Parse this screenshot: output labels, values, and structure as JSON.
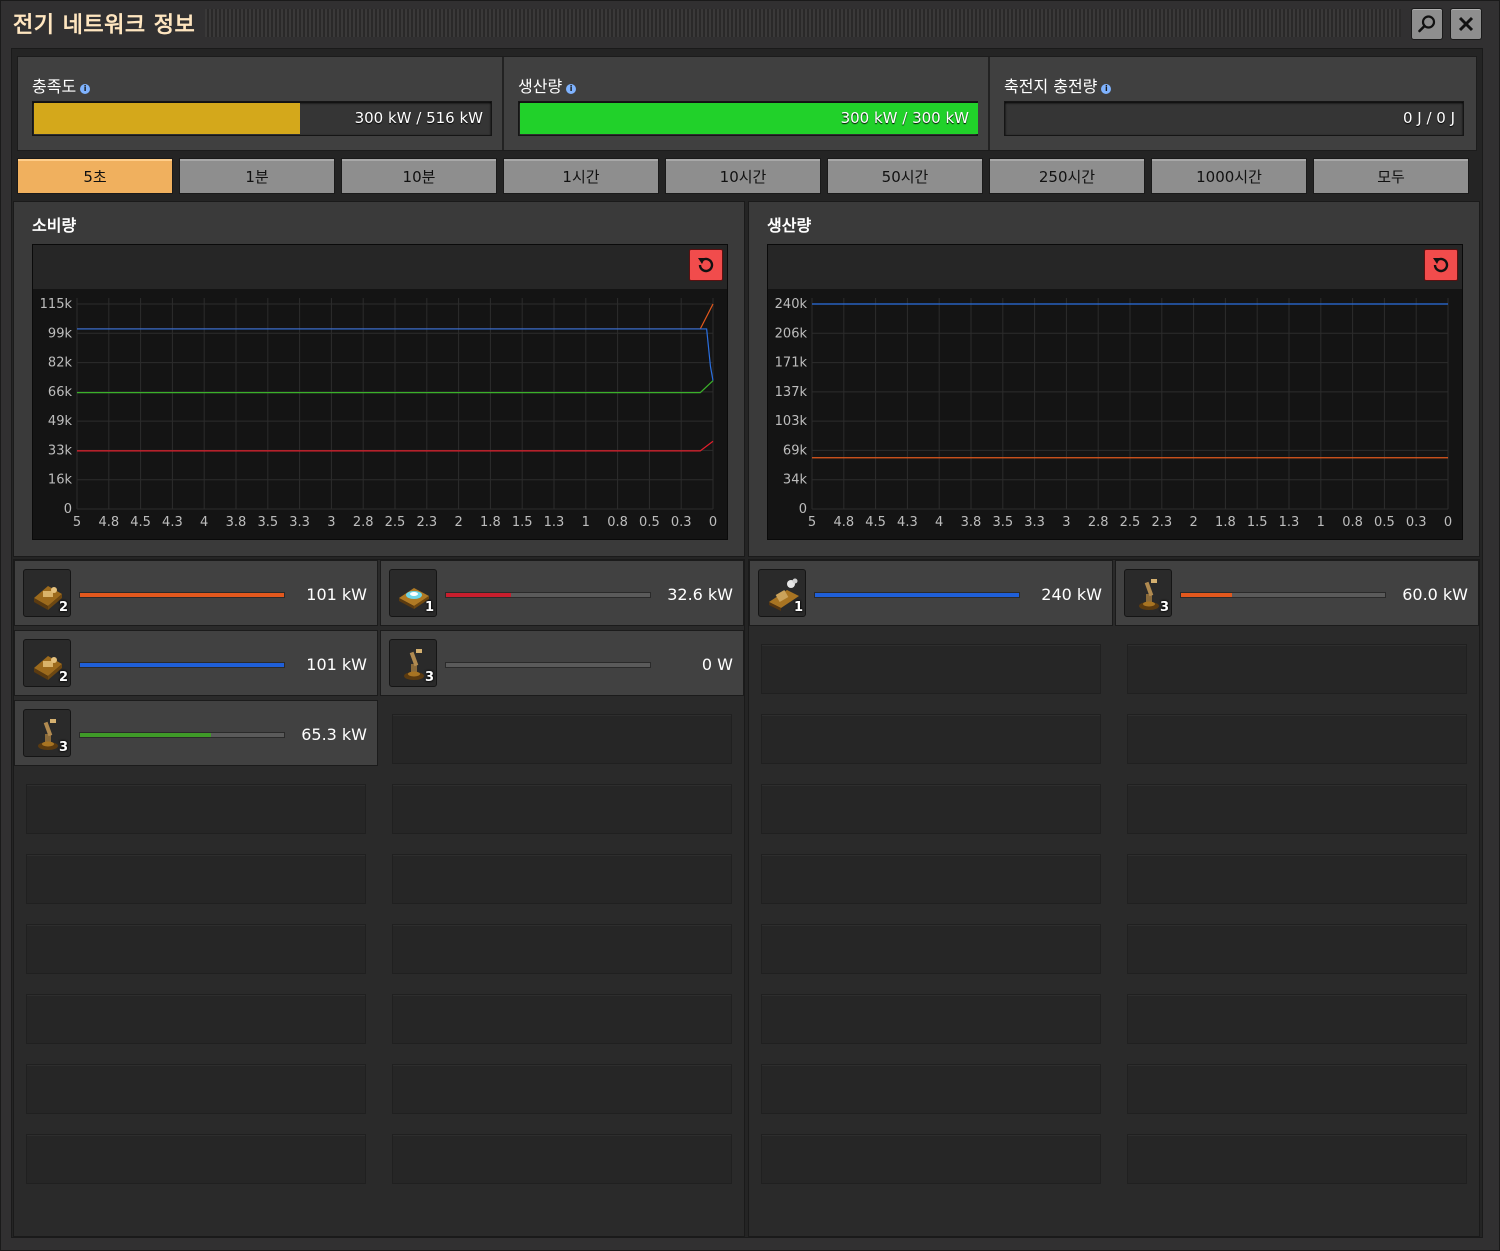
{
  "window": {
    "title": "전기 네트워크 정보"
  },
  "stats": [
    {
      "label": "충족도",
      "value": "300 kW / 516 kW",
      "fill": 0.58,
      "color": "#d4a81b"
    },
    {
      "label": "생산량",
      "value": "300 kW / 300 kW",
      "fill": 1.0,
      "color": "#21d12a"
    },
    {
      "label": "축전지 충전량",
      "value": "0 J / 0 J",
      "fill": 0.0,
      "color": "#d4a81b"
    }
  ],
  "tabs": [
    "5초",
    "1분",
    "10분",
    "1시간",
    "10시간",
    "50시간",
    "250시간",
    "1000시간",
    "모두"
  ],
  "active_tab": "5초",
  "consumption": {
    "title": "소비량"
  },
  "production": {
    "title": "생산량"
  },
  "chart_data": [
    {
      "type": "line",
      "title": "소비량",
      "x_ticks": [
        "5",
        "4.8",
        "4.5",
        "4.3",
        "4",
        "3.8",
        "3.5",
        "3.3",
        "3",
        "2.8",
        "2.5",
        "2.3",
        "2",
        "1.8",
        "1.5",
        "1.3",
        "1",
        "0.8",
        "0.5",
        "0.3",
        "0"
      ],
      "y_ticks": [
        "0",
        "16k",
        "33k",
        "49k",
        "66k",
        "82k",
        "99k",
        "115k"
      ],
      "ylim": [
        0,
        115000
      ],
      "series": [
        {
          "color": "#e2581d",
          "values": [
            [
              5,
              101000
            ],
            [
              0.1,
              101000
            ],
            [
              0,
              115000
            ]
          ]
        },
        {
          "color": "#2a6fe0",
          "values": [
            [
              5,
              101000
            ],
            [
              0.05,
              101000
            ],
            [
              0.02,
              80000
            ],
            [
              0,
              72000
            ]
          ]
        },
        {
          "color": "#3bb02a",
          "values": [
            [
              5,
              65300
            ],
            [
              0.1,
              65300
            ],
            [
              0,
              72000
            ]
          ]
        },
        {
          "color": "#e01f2c",
          "values": [
            [
              5,
              32600
            ],
            [
              0.1,
              32600
            ],
            [
              0,
              38000
            ]
          ]
        }
      ]
    },
    {
      "type": "line",
      "title": "생산량",
      "x_ticks": [
        "5",
        "4.8",
        "4.5",
        "4.3",
        "4",
        "3.8",
        "3.5",
        "3.3",
        "3",
        "2.8",
        "2.5",
        "2.3",
        "2",
        "1.8",
        "1.5",
        "1.3",
        "1",
        "0.8",
        "0.5",
        "0.3",
        "0"
      ],
      "y_ticks": [
        "0",
        "34k",
        "69k",
        "103k",
        "137k",
        "171k",
        "206k",
        "240k"
      ],
      "ylim": [
        0,
        240000
      ],
      "series": [
        {
          "color": "#2a6fe0",
          "values": [
            [
              5,
              240000
            ],
            [
              0,
              240000
            ]
          ]
        },
        {
          "color": "#e2581d",
          "values": [
            [
              5,
              60000
            ],
            [
              0,
              60000
            ]
          ]
        }
      ]
    }
  ],
  "consumers": [
    {
      "count": "2",
      "value": "101 kW",
      "fill": 1.0,
      "color": "#e2581d",
      "icon": "assembling-machine-icon"
    },
    {
      "count": "1",
      "value": "32.6 kW",
      "fill": 0.32,
      "color": "#c81e2d",
      "icon": "lab-icon"
    },
    {
      "count": "2",
      "value": "101 kW",
      "fill": 1.0,
      "color": "#1f5fd8",
      "icon": "assembling-machine-icon"
    },
    {
      "count": "3",
      "value": "0 W",
      "fill": 0.0,
      "color": "#1f5fd8",
      "icon": "inserter-icon"
    },
    {
      "count": "3",
      "value": "65.3 kW",
      "fill": 0.64,
      "color": "#3f9a28",
      "icon": "inserter-icon"
    }
  ],
  "producers": [
    {
      "count": "1",
      "value": "240 kW",
      "fill": 1.0,
      "color": "#1f5fd8",
      "icon": "steam-engine-icon"
    },
    {
      "count": "3",
      "value": "60.0 kW",
      "fill": 0.25,
      "color": "#e2581d",
      "icon": "inserter-icon"
    }
  ]
}
